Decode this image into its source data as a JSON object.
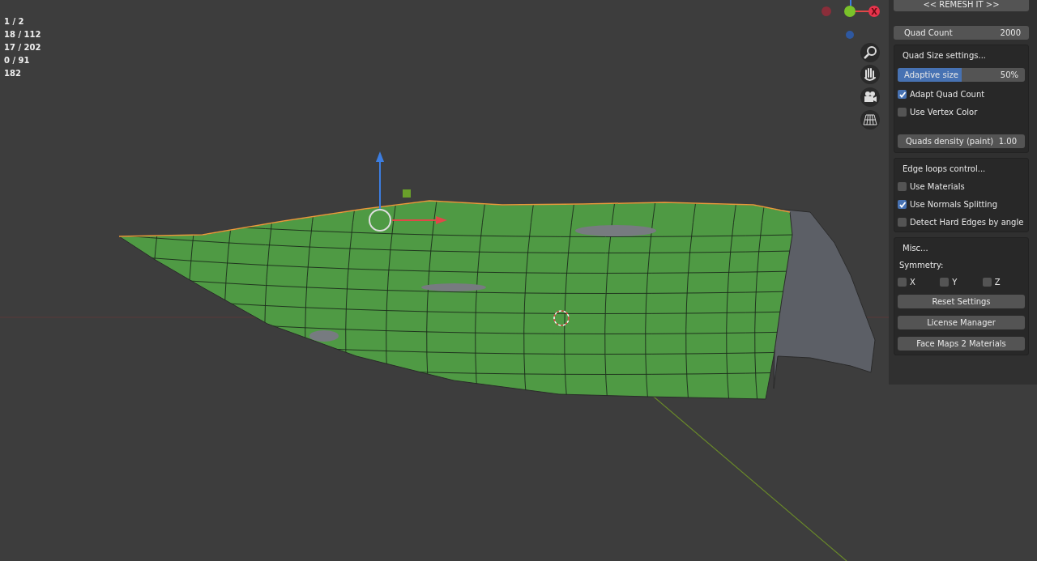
{
  "stats": [
    "1 / 2",
    "18 / 112",
    "17 / 202",
    "0 / 91",
    "182"
  ],
  "gizmo": {
    "x_label": "X"
  },
  "panel": {
    "remesh_button": "<<  REMESH IT  >>",
    "quad_count": {
      "label": "Quad Count",
      "value": "2000"
    },
    "sections": [
      {
        "title": "Quad Size settings...",
        "items": [
          {
            "kind": "slider",
            "label": "Adaptive size",
            "reading": "50%",
            "level": 0.5
          },
          {
            "kind": "checkbox",
            "label": "Adapt Quad Count",
            "checked": true
          },
          {
            "kind": "checkbox",
            "label": "Use Vertex Color",
            "checked": false
          },
          {
            "kind": "field",
            "label": "Quads density (paint)",
            "value": "1.00"
          }
        ]
      },
      {
        "title": "Edge loops control...",
        "items": [
          {
            "kind": "checkbox",
            "label": "Use Materials",
            "checked": false
          },
          {
            "kind": "checkbox",
            "label": "Use Normals Splitting",
            "checked": true
          },
          {
            "kind": "checkbox",
            "label": "Detect Hard Edges by angle",
            "checked": false
          }
        ]
      },
      {
        "title": "Misc...",
        "items": [
          {
            "kind": "label",
            "label": "Symmetry:"
          },
          {
            "kind": "axes",
            "options": [
              {
                "label": "X",
                "checked": false
              },
              {
                "label": "Y",
                "checked": false
              },
              {
                "label": "Z",
                "checked": false
              }
            ]
          },
          {
            "kind": "button",
            "label": "Reset Settings"
          },
          {
            "kind": "button",
            "label": "License Manager"
          },
          {
            "kind": "button",
            "label": "Face Maps 2 Materials"
          }
        ]
      }
    ]
  }
}
